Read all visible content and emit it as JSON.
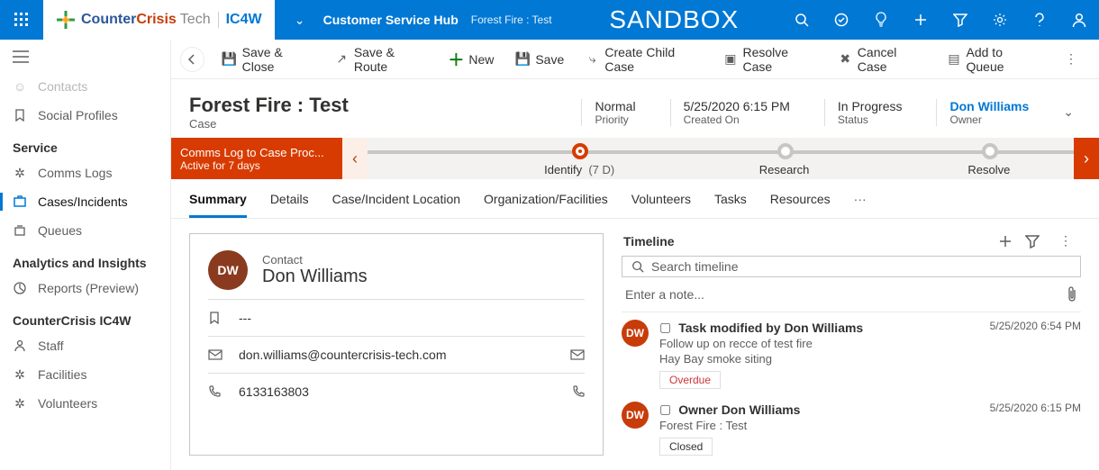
{
  "topbar": {
    "brand_counter": "Counter",
    "brand_crisis": "Crisis",
    "brand_tech": " Tech",
    "brand_ic": "IC4W",
    "hub": "Customer Service Hub",
    "breadcrumb": "Forest Fire : Test",
    "sandbox": "SANDBOX"
  },
  "sidebar": {
    "contacts": "Contacts",
    "social": "Social Profiles",
    "grp_service": "Service",
    "comms": "Comms Logs",
    "cases": "Cases/Incidents",
    "queues": "Queues",
    "grp_analytics": "Analytics and Insights",
    "reports": "Reports (Preview)",
    "grp_cc": "CounterCrisis IC4W",
    "staff": "Staff",
    "facilities": "Facilities",
    "volunteers": "Volunteers"
  },
  "cmd": {
    "saveclose": "Save & Close",
    "saveroute": "Save & Route",
    "new": "New",
    "save": "Save",
    "createchild": "Create Child Case",
    "resolve": "Resolve Case",
    "cancel": "Cancel Case",
    "queue": "Add to Queue"
  },
  "record": {
    "title": "Forest Fire : Test",
    "entity": "Case",
    "priority": "Normal",
    "priority_lbl": "Priority",
    "created": "5/25/2020 6:15 PM",
    "created_lbl": "Created On",
    "status": "In Progress",
    "status_lbl": "Status",
    "owner": "Don Williams",
    "owner_lbl": "Owner"
  },
  "bpf": {
    "stage_title": "Comms Log to Case Proc...",
    "stage_sub": "Active for 7 days",
    "s1": "Identify",
    "s1_dur": "(7 D)",
    "s2": "Research",
    "s3": "Resolve"
  },
  "tabs": {
    "summary": "Summary",
    "details": "Details",
    "location": "Case/Incident Location",
    "org": "Organization/Facilities",
    "vol": "Volunteers",
    "tasks": "Tasks",
    "res": "Resources"
  },
  "contact": {
    "label": "Contact",
    "initials": "DW",
    "name": "Don Williams",
    "bookmark": "---",
    "email": "don.williams@countercrisis-tech.com",
    "phone": "6133163803"
  },
  "timeline": {
    "title": "Timeline",
    "search_ph": "Search timeline",
    "note_ph": "Enter a note...",
    "items": [
      {
        "initials": "DW",
        "title": "Task modified by Don Williams",
        "line1": "Follow up on recce of test fire",
        "line2": "Hay Bay smoke siting",
        "badge": "Overdue",
        "badge_style": "red",
        "ts": "5/25/2020 6:54 PM"
      },
      {
        "initials": "DW",
        "title": "Owner Don Williams",
        "line1": "Forest Fire : Test",
        "line2": "",
        "badge": "Closed",
        "badge_style": "grey",
        "ts": "5/25/2020 6:15 PM"
      }
    ]
  }
}
